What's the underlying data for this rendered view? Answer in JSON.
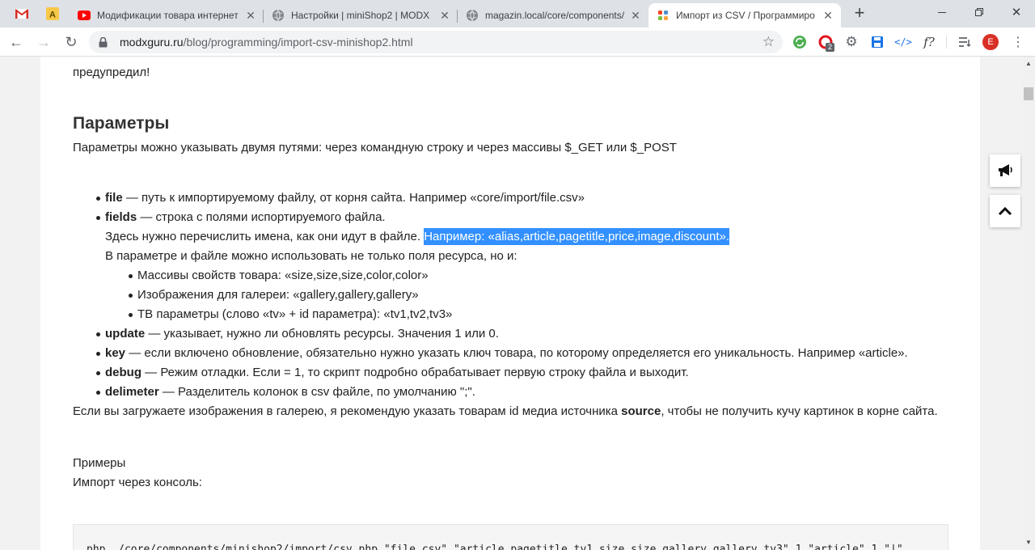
{
  "browser": {
    "tabs": [
      {
        "title": "Модификации товара интернет",
        "favicon": "youtube-icon",
        "active": false
      },
      {
        "title": "Настройки | miniShop2 | MODX",
        "favicon": "globe-icon",
        "active": false
      },
      {
        "title": "magazin.local/core/components/",
        "favicon": "globe-icon",
        "active": false
      },
      {
        "title": "Импорт из CSV / Программиро",
        "favicon": "joomla-icon",
        "active": true
      }
    ],
    "pinned_tabs": [
      "gmail-icon",
      "yandex-icon"
    ],
    "address": {
      "host": "modxguru.ru",
      "path": "/blog/programming/import-csv-minishop2.html"
    },
    "extensions": {
      "opera_badge": "2",
      "formula_label": "f?",
      "profile_initial": "E"
    },
    "colors": {
      "selection": "#3390ff",
      "profile": "#d93025"
    }
  },
  "article": {
    "top_fragment": "предупредил!",
    "heading": "Параметры",
    "intro": "Параметры можно указывать двумя путями: через командную строку и через массивы $_GET или $_POST",
    "params": [
      {
        "term": "file",
        "desc": " — путь к импортируемому файлу, от корня сайта. Например «core/import/file.csv»"
      },
      {
        "term": "fields",
        "desc": " — строка с полями испортируемого файла."
      }
    ],
    "fields_line2": "Здесь нужно перечислить имена, как они идут в файле. ",
    "fields_selected": "Например: «alias,article,pagetitle,price,image,discount».",
    "fields_line3": "В параметре и файле можно использовать не только поля ресурса, но и:",
    "sub_items": [
      "Массивы свойств товара: «size,size,size,color,color»",
      "Изображения для галереи: «gallery,gallery,gallery»",
      "ТВ параметры (слово «tv» + id параметра): «tv1,tv2,tv3»"
    ],
    "params2": [
      {
        "term": "update",
        "desc": " — указывает, нужно ли обновлять ресурсы. Значения 1 или 0."
      },
      {
        "term": "key",
        "desc": " — если включено обновление, обязательно нужно указать ключ товара, по которому определяется его уникальность. Например «article»."
      },
      {
        "term": "debug",
        "desc": " — Режим отладки. Если = 1, то скрипт подробно обрабатывает первую строку файла и выходит."
      },
      {
        "term": "delimeter",
        "desc": " — Разделитель колонок в csv файле, по умолчанию \";\"."
      }
    ],
    "gallery_note_before": "Если вы загружаете изображения в галерею, я рекомендую указать товарам id медиа источника ",
    "gallery_note_bold": "source",
    "gallery_note_after": ", чтобы не получить кучу картинок в корне сайта.",
    "examples_label": "Примеры",
    "console_label": "Импорт через консоль:",
    "code": "php ./core/components/minishop2/import/csv.php \"file.csv\" \"article,pagetitle,tv1,size,size,gallery,gallery,tv3\" 1 \"article\" 1 \"|\""
  }
}
